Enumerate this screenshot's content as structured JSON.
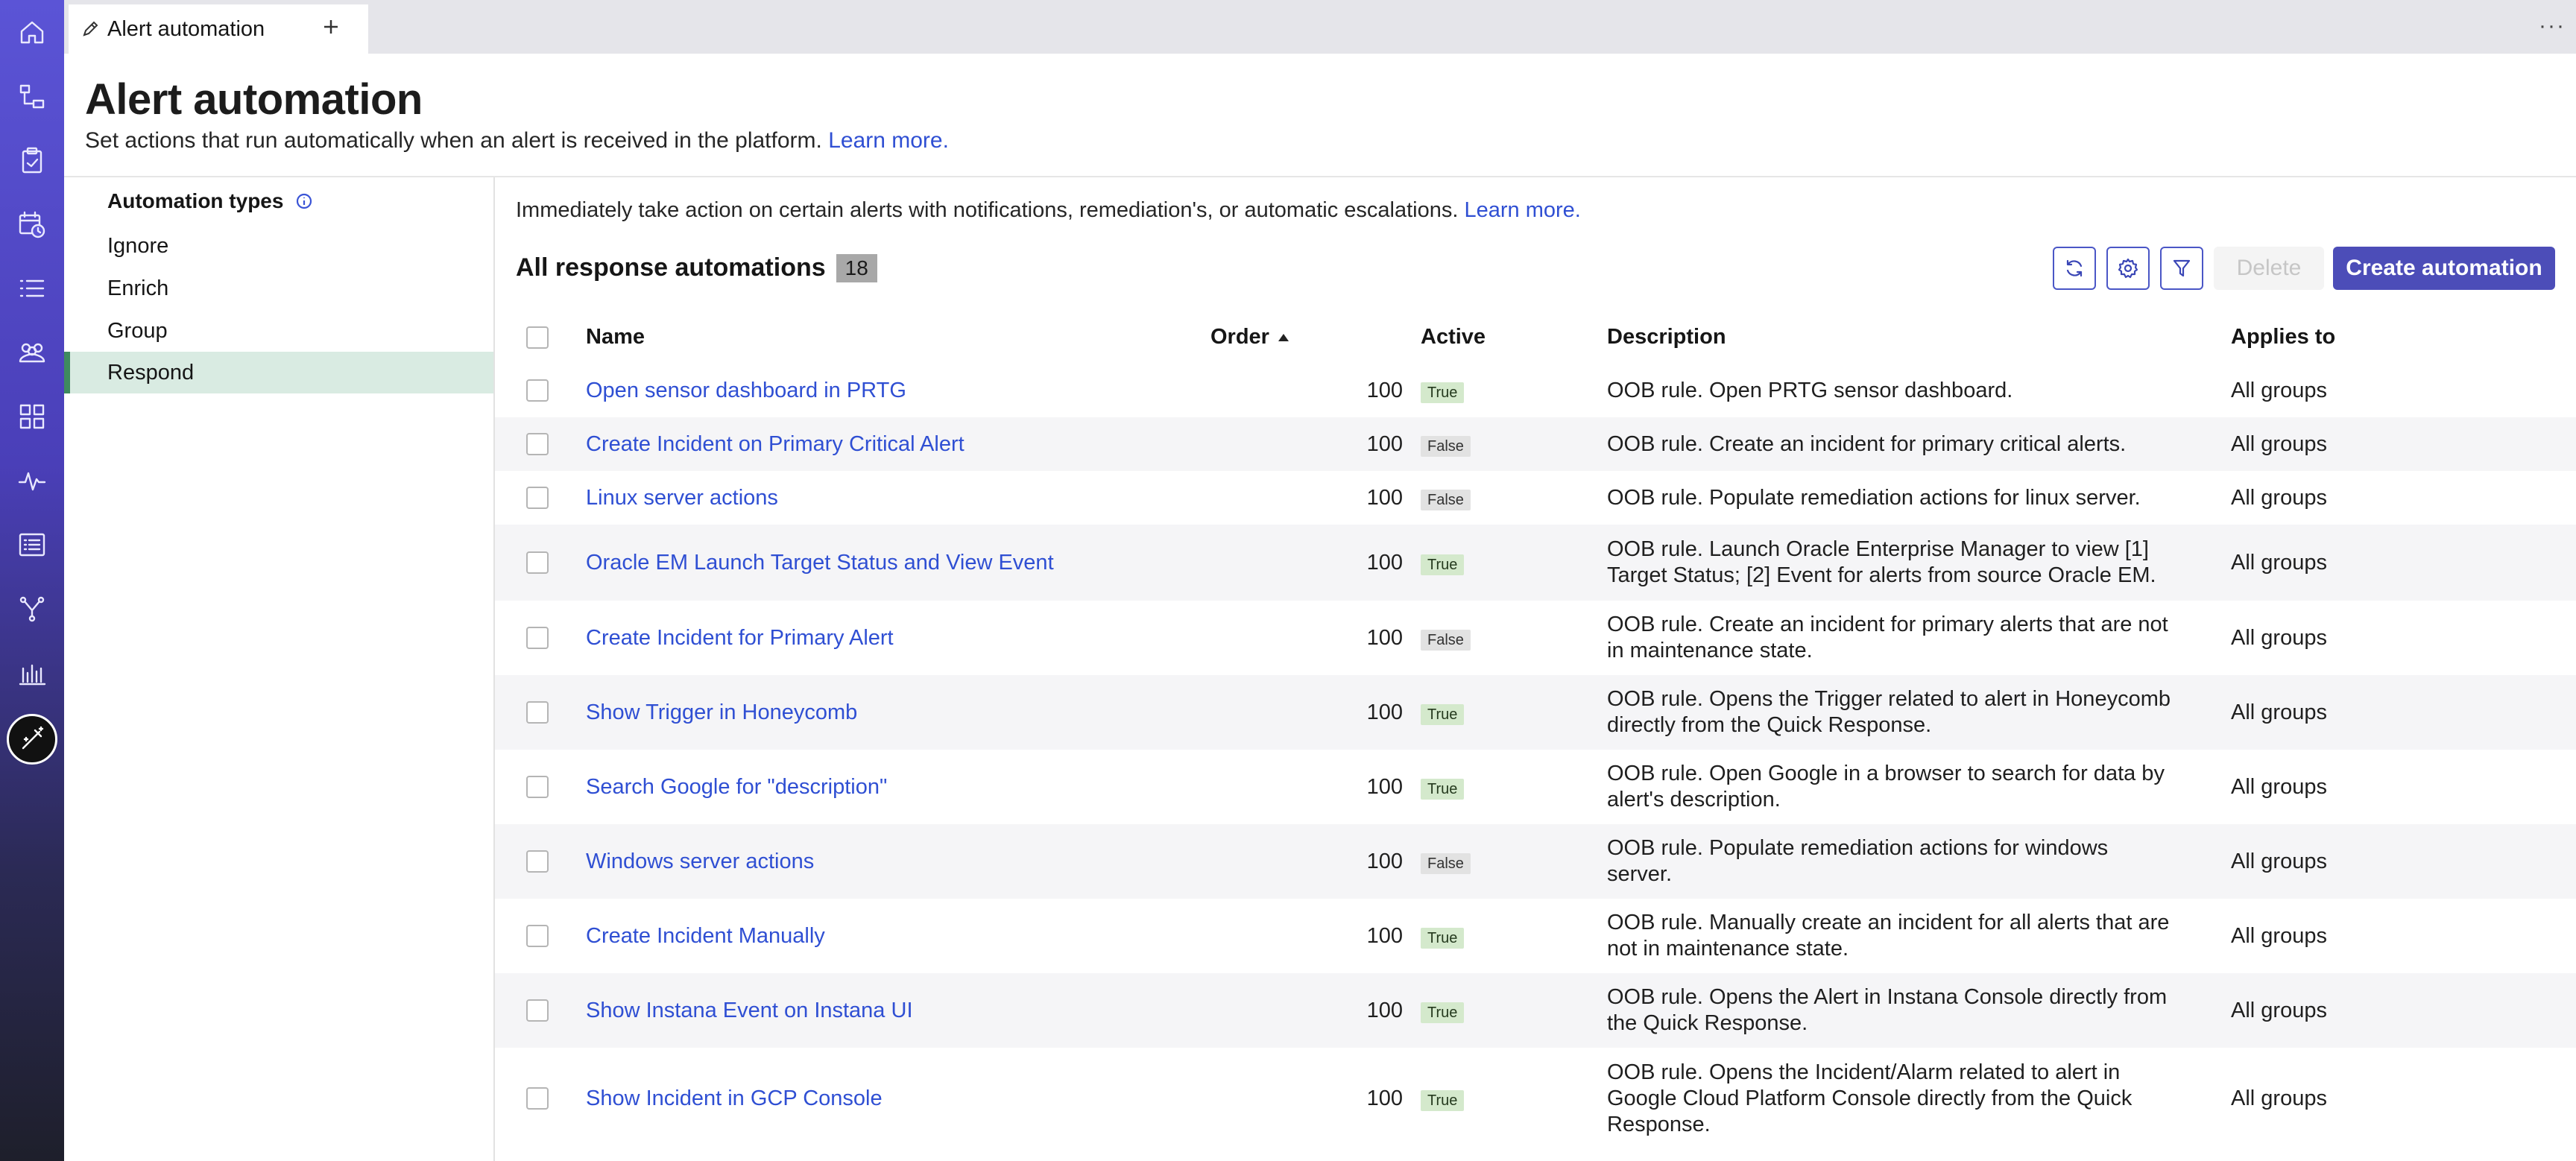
{
  "tab": {
    "label": "Alert automation"
  },
  "header": {
    "title": "Alert automation",
    "subtitle": "Set actions that run automatically when an alert is received in the platform.",
    "learn_more": "Learn more."
  },
  "sidebar": {
    "heading": "Automation types",
    "items": [
      {
        "label": "Ignore"
      },
      {
        "label": "Enrich"
      },
      {
        "label": "Group"
      },
      {
        "label": "Respond"
      }
    ]
  },
  "main": {
    "intro": "Immediately take action on certain alerts with notifications, remediation's, or automatic escalations.",
    "intro_link": "Learn more.",
    "list_title": "All response automations",
    "count": "18",
    "delete_label": "Delete",
    "create_label": "Create automation"
  },
  "table": {
    "columns": {
      "name": "Name",
      "order": "Order",
      "active": "Active",
      "description": "Description",
      "applies": "Applies to"
    },
    "rows": [
      {
        "name": "Open sensor dashboard in PRTG",
        "order": "100",
        "active": "True",
        "description": "OOB rule. Open PRTG sensor dashboard.",
        "applies": "All groups"
      },
      {
        "name": "Create Incident on Primary Critical Alert",
        "order": "100",
        "active": "False",
        "description": "OOB rule. Create an incident for primary critical alerts.",
        "applies": "All groups"
      },
      {
        "name": "Linux server actions",
        "order": "100",
        "active": "False",
        "description": "OOB rule. Populate remediation actions for linux server.",
        "applies": "All groups"
      },
      {
        "name": "Oracle EM Launch Target Status and View Event",
        "order": "100",
        "active": "True",
        "description": "OOB rule. Launch Oracle Enterprise Manager to view [1] Target Status; [2] Event for alerts from source Oracle EM.",
        "applies": "All groups"
      },
      {
        "name": "Create Incident for Primary Alert",
        "order": "100",
        "active": "False",
        "description": "OOB rule. Create an incident for primary alerts that are not in maintenance state.",
        "applies": "All groups"
      },
      {
        "name": "Show Trigger in Honeycomb",
        "order": "100",
        "active": "True",
        "description": "OOB rule. Opens the Trigger related to alert in Honeycomb directly from the Quick Response.",
        "applies": "All groups"
      },
      {
        "name": "Search Google for \"description\"",
        "order": "100",
        "active": "True",
        "description": "OOB rule. Open Google in a browser to search for data by alert's description.",
        "applies": "All groups"
      },
      {
        "name": "Windows server actions",
        "order": "100",
        "active": "False",
        "description": "OOB rule. Populate remediation actions for windows server.",
        "applies": "All groups"
      },
      {
        "name": "Create Incident Manually",
        "order": "100",
        "active": "True",
        "description": "OOB rule. Manually create an incident for all alerts that are not in maintenance state.",
        "applies": "All groups"
      },
      {
        "name": "Show Instana Event on Instana UI",
        "order": "100",
        "active": "True",
        "description": "OOB rule. Opens the Alert in Instana Console directly from the Quick Response.",
        "applies": "All groups"
      },
      {
        "name": "Show Incident in GCP Console",
        "order": "100",
        "active": "True",
        "description": "OOB rule. Opens the Incident/Alarm related to alert in Google Cloud Platform Console directly from the Quick Response.",
        "applies": "All groups"
      }
    ]
  },
  "rail_icons": [
    "home-icon",
    "topology-icon",
    "clipboard-icon",
    "calendar-clock-icon",
    "list-icon",
    "team-icon",
    "grid-icon",
    "pulse-icon",
    "table-list-icon",
    "branch-icon",
    "bar-chart-icon",
    "wand-icon"
  ],
  "colors": {
    "accent": "#4c4db8",
    "link": "#2f4fd3",
    "active_nav": "#d9ebe2"
  }
}
